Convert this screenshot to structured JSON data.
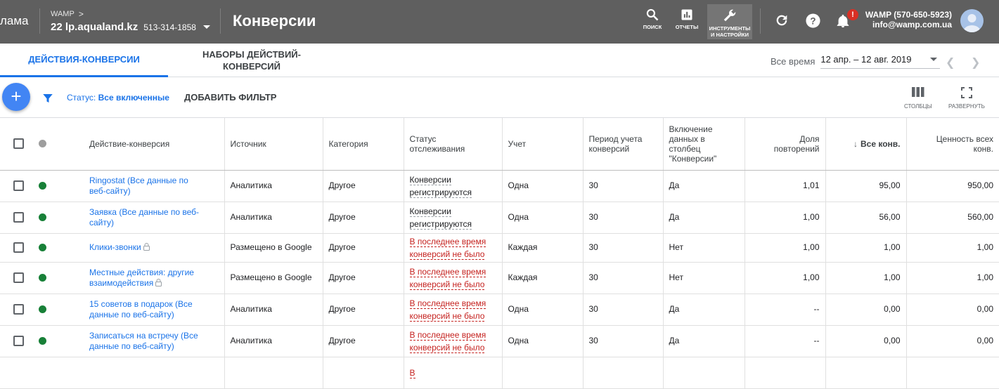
{
  "topbar": {
    "brand": "лама",
    "account_top": "WAMP",
    "account_name": "22 lp.aqualand.kz",
    "account_id": "513-314-1858",
    "page_title": "Конверсии",
    "tools": {
      "search": "ПОИСК",
      "reports": "ОТЧЕТЫ",
      "tools_line1": "ИНСТРУМЕНТЫ",
      "tools_line2": "И НАСТРОЙКИ"
    },
    "notif_count": "!",
    "user_name": "WAMP (570-650-5923)",
    "user_email": "info@wamp.com.ua"
  },
  "tabs": [
    "ДЕЙСТВИЯ-КОНВЕРСИИ",
    "НАБОРЫ ДЕЙСТВИЙ-",
    "КОНВЕРСИЙ"
  ],
  "date": {
    "label": "Все время",
    "range": "12 апр. – 12 авг. 2019"
  },
  "filterbar": {
    "status_prefix": "Статус:",
    "status_value": "Все включенные",
    "add_filter": "ДОБАВИТЬ ФИЛЬТР",
    "columns": "СТОЛБЦЫ",
    "expand": "РАЗВЕРНУТЬ"
  },
  "table": {
    "headers": {
      "action": "Действие-конверсия",
      "source": "Источник",
      "category": "Категория",
      "tracking": [
        "Статус",
        "отслеживания"
      ],
      "count": "Учет",
      "window": [
        "Период учета",
        "конверсий"
      ],
      "include": [
        "Включение",
        "данных в",
        "столбец",
        "\"Конверсии\""
      ],
      "repeat": [
        "Доля",
        "повторений"
      ],
      "all_conv": "Все конв.",
      "value": [
        "Ценность всех",
        "конв."
      ]
    },
    "rows": [
      {
        "name": [
          "Ringostat (Все данные по",
          "веб-сайту)"
        ],
        "locked": false,
        "source": "Аналитика",
        "category": "Другое",
        "status": [
          "Конверсии",
          "регистрируются"
        ],
        "status_ok": true,
        "count": "Одна",
        "window": "30",
        "include": "Да",
        "repeat": "1,01",
        "all_conv": "95,00",
        "value": "950,00"
      },
      {
        "name": [
          "Заявка (Все данные по веб-",
          "сайту)"
        ],
        "locked": false,
        "source": "Аналитика",
        "category": "Другое",
        "status": [
          "Конверсии",
          "регистрируются"
        ],
        "status_ok": true,
        "count": "Одна",
        "window": "30",
        "include": "Да",
        "repeat": "1,00",
        "all_conv": "56,00",
        "value": "560,00"
      },
      {
        "name": [
          "Клики-звонки",
          ""
        ],
        "locked": true,
        "source": "Размещено в Google",
        "category": "Другое",
        "status": [
          "В последнее время",
          "конверсий не было"
        ],
        "status_ok": false,
        "count": "Каждая",
        "window": "30",
        "include": "Нет",
        "repeat": "1,00",
        "all_conv": "1,00",
        "value": "1,00"
      },
      {
        "name": [
          "Местные действия: другие",
          "взаимодействия"
        ],
        "locked": true,
        "source": "Размещено в Google",
        "category": "Другое",
        "status": [
          "В последнее время",
          "конверсий не было"
        ],
        "status_ok": false,
        "count": "Каждая",
        "window": "30",
        "include": "Нет",
        "repeat": "1,00",
        "all_conv": "1,00",
        "value": "1,00"
      },
      {
        "name": [
          "15 советов в подарок (Все",
          "данные по веб-сайту)"
        ],
        "locked": false,
        "source": "Аналитика",
        "category": "Другое",
        "status": [
          "В последнее время",
          "конверсий не было"
        ],
        "status_ok": false,
        "count": "Одна",
        "window": "30",
        "include": "Да",
        "repeat": "--",
        "all_conv": "0,00",
        "value": "0,00"
      },
      {
        "name": [
          "Записаться на встречу (Все",
          "данные по веб-сайту)"
        ],
        "locked": false,
        "source": "Аналитика",
        "category": "Другое",
        "status": [
          "В последнее время",
          "конверсий не было"
        ],
        "status_ok": false,
        "count": "Одна",
        "window": "30",
        "include": "Да",
        "repeat": "--",
        "all_conv": "0,00",
        "value": "0,00"
      },
      {
        "name": [
          "",
          ""
        ],
        "locked": false,
        "source": "",
        "category": "",
        "status": [
          "В",
          ""
        ],
        "status_ok": false,
        "count": "",
        "window": "",
        "include": "",
        "repeat": "",
        "all_conv": "",
        "value": ""
      }
    ]
  }
}
